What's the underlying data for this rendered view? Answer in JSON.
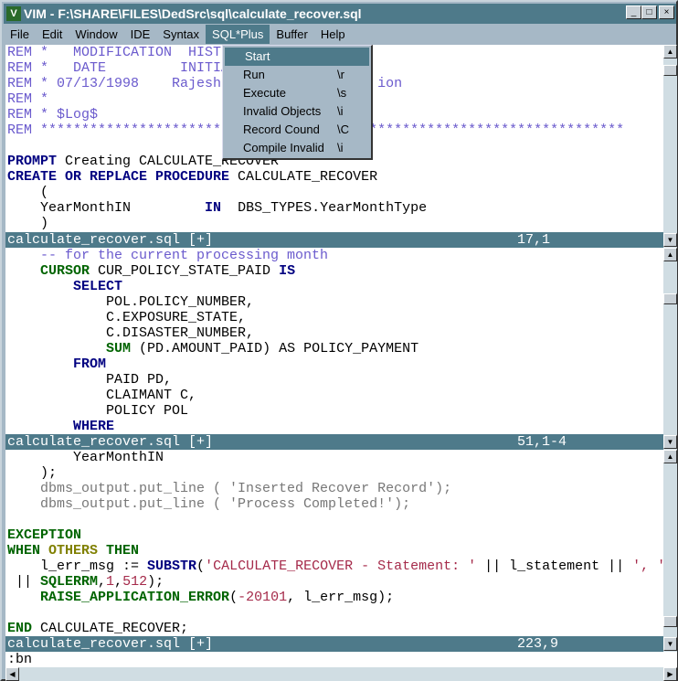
{
  "window": {
    "title": "VIM - F:\\SHARE\\FILES\\DedSrc\\sql\\calculate_recover.sql",
    "logo": "V",
    "minimize": "_",
    "maximize": "□",
    "close": "×"
  },
  "menubar": [
    "File",
    "Edit",
    "Window",
    "IDE",
    "Syntax",
    "SQL*Plus",
    "Buffer",
    "Help"
  ],
  "menu": {
    "items": [
      {
        "label": "Start",
        "shortcut": ""
      },
      {
        "label": "Run",
        "shortcut": "\\r"
      },
      {
        "label": "Execute",
        "shortcut": "\\s"
      },
      {
        "label": "Invalid Objects",
        "shortcut": "\\i"
      },
      {
        "label": "Record Cound",
        "shortcut": "\\C"
      },
      {
        "label": "Compile Invalid",
        "shortcut": "\\i"
      }
    ]
  },
  "panes": [
    {
      "lines": [
        [
          [
            "REM *   MODIFICATION  HIST",
            "c"
          ]
        ],
        [
          [
            "REM *   DATE         INITIA",
            "c"
          ]
        ],
        [
          [
            "REM * 07/13/1998    Rajesh                   ion",
            "c"
          ]
        ],
        [
          [
            "REM *",
            "c"
          ]
        ],
        [
          [
            "REM * $Log$",
            "c"
          ]
        ],
        [
          [
            "REM ***********************************************************************",
            "c"
          ]
        ],
        [
          [
            "",
            ""
          ]
        ],
        [
          [
            "PROMPT ",
            "k"
          ],
          [
            "Creating CALCULATE_RECOVER",
            "n"
          ]
        ],
        [
          [
            "CREATE OR REPLACE PROCEDURE ",
            "k"
          ],
          [
            "CALCULATE_RECOVER",
            "n"
          ]
        ],
        [
          [
            "    (",
            "n"
          ]
        ],
        [
          [
            "    YearMonthIN         ",
            "n"
          ],
          [
            "IN",
            "k"
          ],
          [
            "  DBS_TYPES.YearMonthType",
            "n"
          ]
        ],
        [
          [
            "    )",
            "n"
          ]
        ]
      ],
      "status": {
        "file": "calculate_recover.sql [+]",
        "pos": "17,1"
      }
    },
    {
      "lines": [
        [
          [
            "    -- for the current processing month",
            "c"
          ]
        ],
        [
          [
            "    ",
            "n"
          ],
          [
            "CURSOR",
            "g"
          ],
          [
            " CUR_POLICY_STATE_PAID ",
            "n"
          ],
          [
            "IS",
            "k"
          ]
        ],
        [
          [
            "        ",
            "n"
          ],
          [
            "SELECT",
            "k"
          ]
        ],
        [
          [
            "            POL.POLICY_NUMBER,",
            "n"
          ]
        ],
        [
          [
            "            C.EXPOSURE_STATE,",
            "n"
          ]
        ],
        [
          [
            "            C.DISASTER_NUMBER,",
            "n"
          ]
        ],
        [
          [
            "            ",
            "n"
          ],
          [
            "SUM",
            "g"
          ],
          [
            " (PD.AMOUNT_PAID) AS POLICY_PAYMENT",
            "n"
          ]
        ],
        [
          [
            "        ",
            "n"
          ],
          [
            "FROM",
            "k"
          ]
        ],
        [
          [
            "            PAID PD,",
            "n"
          ]
        ],
        [
          [
            "            CLAIMANT C,",
            "n"
          ]
        ],
        [
          [
            "            POLICY POL",
            "n"
          ]
        ],
        [
          [
            "        ",
            "n"
          ],
          [
            "WHERE",
            "k"
          ]
        ]
      ],
      "status": {
        "file": "calculate_recover.sql [+]",
        "pos": "51,1-4"
      }
    },
    {
      "lines": [
        [
          [
            "        YearMonthIN",
            "n"
          ]
        ],
        [
          [
            "    );",
            "n"
          ]
        ],
        [
          [
            "    dbms_output.put_line ( 'Inserted Recover Record');",
            "gr"
          ]
        ],
        [
          [
            "    dbms_output.put_line ( 'Process Completed!');",
            "gr"
          ]
        ],
        [
          [
            "",
            ""
          ]
        ],
        [
          [
            "EXCEPTION",
            "g"
          ]
        ],
        [
          [
            "WHEN ",
            "g"
          ],
          [
            "OTHERS",
            "o"
          ],
          [
            " THEN",
            "g"
          ]
        ],
        [
          [
            "    l_err_msg := ",
            "n"
          ],
          [
            "SUBSTR",
            "k"
          ],
          [
            "(",
            "n"
          ],
          [
            "'CALCULATE_RECOVER - Statement: '",
            "s"
          ],
          [
            " || l_statement || ",
            "n"
          ],
          [
            "', '",
            "s"
          ]
        ],
        [
          [
            " || ",
            "n"
          ],
          [
            "SQLERRM",
            "g"
          ],
          [
            ",",
            "n"
          ],
          [
            "1",
            "s"
          ],
          [
            ",",
            "n"
          ],
          [
            "512",
            "s"
          ],
          [
            ");",
            "n"
          ]
        ],
        [
          [
            "    ",
            "n"
          ],
          [
            "RAISE_APPLICATION_ERROR",
            "g"
          ],
          [
            "(",
            "n"
          ],
          [
            "-20101",
            "s"
          ],
          [
            ", l_err_msg);",
            "n"
          ]
        ],
        [
          [
            "",
            ""
          ]
        ],
        [
          [
            "END",
            "g"
          ],
          [
            " CALCULATE_RECOVER;",
            "n"
          ]
        ]
      ],
      "status": {
        "file": "calculate_recover.sql [+]",
        "pos": "223,9"
      }
    }
  ],
  "cmdline": ":bn"
}
